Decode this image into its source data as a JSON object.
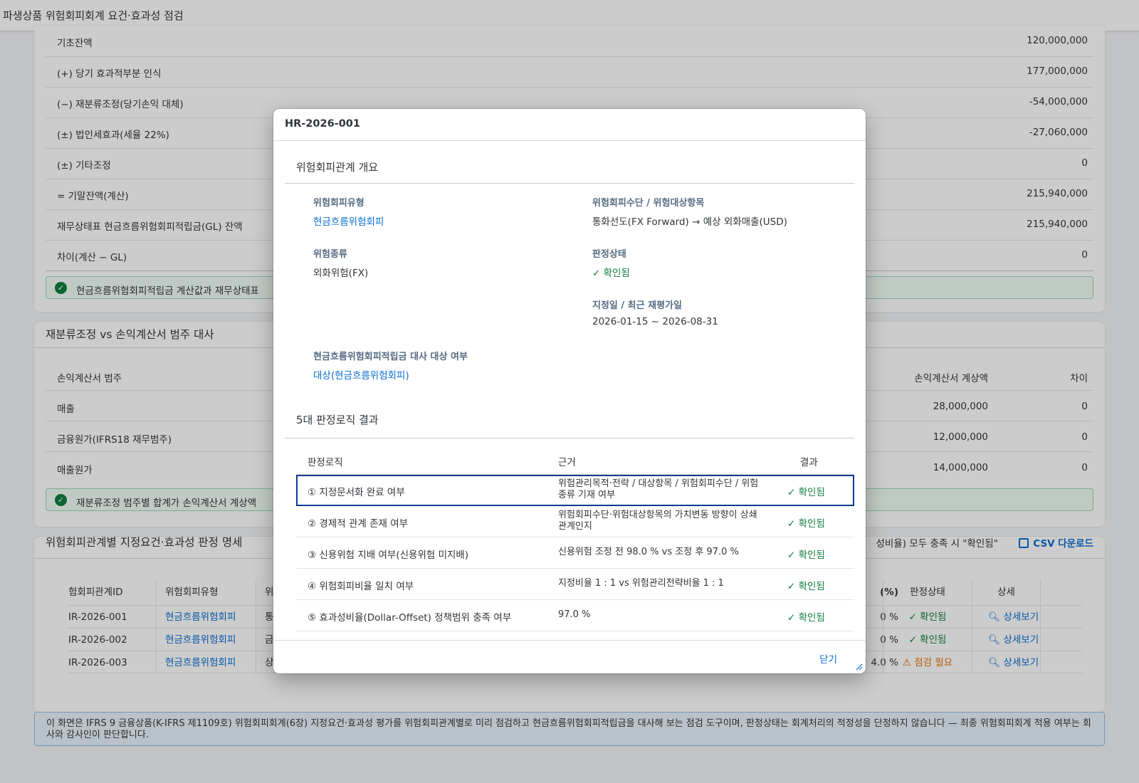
{
  "page": {
    "title": "파생상품 위험회피회계 요건·효과성 점검"
  },
  "summary": {
    "rows": [
      {
        "label": "기초잔액",
        "value": "120,000,000"
      },
      {
        "label": "(+) 당기 효과적부분 인식",
        "value": "177,000,000"
      },
      {
        "label": "(−) 재분류조정(당기손익 대체)",
        "value": "-54,000,000"
      },
      {
        "label": "(±) 법인세효과(세율 22%)",
        "value": "-27,060,000"
      },
      {
        "label": "(±) 기타조정",
        "value": "0"
      },
      {
        "label": "= 기말잔액(계산)",
        "value": "215,940,000"
      },
      {
        "label": "재무상태표 현금흐름위험회피적립금(GL) 잔액",
        "value": "215,940,000"
      },
      {
        "label": "차이(계산 − GL)",
        "value": "0"
      }
    ],
    "message": "현금흐름위험회피적립금 계산값과 재무상태표"
  },
  "reclass": {
    "title": "재분류조정 vs 손익계산서 범주 대사",
    "headers": {
      "category": "손익계산서 범주",
      "pl_amount": "손익계산서 계상액",
      "diff": "차이"
    },
    "rows": [
      {
        "category": "매출",
        "pl_amount": "28,000,000",
        "diff": "0"
      },
      {
        "category": "금융원가(IFRS18 재무범주)",
        "pl_amount": "12,000,000",
        "diff": "0"
      },
      {
        "category": "매출원가",
        "pl_amount": "14,000,000",
        "diff": "0"
      }
    ],
    "message": "재분류조정 범주별 합계가 손익계산서 계상액"
  },
  "detail": {
    "title": "위험회피관계별 지정요건·효과성 판정 명세",
    "note_right": "성비율) 모두 충족 시 \"확인됨\"",
    "csv_label": "CSV 다운로드",
    "headers": {
      "id": "험회피관계ID",
      "type": "위험회피유형",
      "col3": "위",
      "pct": "(%)",
      "status": "판정상태",
      "detail": "상세"
    },
    "rows": [
      {
        "id": "IR-2026-001",
        "type": "현금흐름위험회피",
        "col3": "통",
        "pct": "0 %",
        "status": "확인됨",
        "status_kind": "ok",
        "detail": "상세보기"
      },
      {
        "id": "IR-2026-002",
        "type": "현금흐름위험회피",
        "col3": "금",
        "pct": "0 %",
        "status": "확인됨",
        "status_kind": "ok",
        "detail": "상세보기"
      },
      {
        "id": "IR-2026-003",
        "type": "현금흐름위험회피",
        "col3": "상",
        "pct": "4.0 %",
        "status": "점검 필요",
        "status_kind": "warn",
        "detail": "상세보기"
      }
    ]
  },
  "info_text": "이 화면은 IFRS 9 금융상품(K-IFRS 제1109호) 위험회피회계(6장) 지정요건·효과성 평가를 위험회피관계별로 미리 점검하고 현금흐름위험회피적립금을 대사해 보는 점검 도구이며, 판정상태는 회계처리의 적정성을 단정하지 않습니다 — 최종 위험회피회계 적용 여부는 회사와 감사인이 판단합니다.",
  "dialog": {
    "title": "HR-2026-001",
    "overview_title": "위험회피관계 개요",
    "fields": {
      "hedge_type_label": "위험회피유형",
      "hedge_type_value": "현금흐름위험회피",
      "instrument_label": "위험회피수단 / 위험대상항목",
      "instrument_value": "통화선도(FX Forward) → 예상 외화매출(USD)",
      "risk_type_label": "위험종류",
      "risk_type_value": "외화위험(FX)",
      "status_label": "판정상태",
      "status_value": "✓ 확인됨",
      "date_label": "지정일 / 최근 재평가일",
      "date_value": "2026-01-15 ~ 2026-08-31",
      "reserve_label": "현금흐름위험회피적립금 대사 대상 여부",
      "reserve_value": "대상(현금흐름위험회피)"
    },
    "logic_title": "5대 판정로직 결과",
    "logic_headers": {
      "logic": "판정로직",
      "basis": "근거",
      "result": "결과"
    },
    "logic_rows": [
      {
        "logic": "① 지정문서화 완료 여부",
        "basis": "위험관리목적·전략 / 대상항목 / 위험회피수단 / 위험종류 기재 여부",
        "result": "확인됨"
      },
      {
        "logic": "② 경제적 관계 존재 여부",
        "basis": "위험회피수단·위험대상항목의 가치변동 방향이 상쇄관계인지",
        "result": "확인됨"
      },
      {
        "logic": "③ 신용위험 지배 여부(신용위험 미지배)",
        "basis": "신용위험 조정 전 98.0 % vs 조정 후 97.0 %",
        "result": "확인됨"
      },
      {
        "logic": "④ 위험회피비율 일치 여부",
        "basis": "지정비율 1 : 1 vs 위험관리전략비율 1 : 1",
        "result": "확인됨"
      },
      {
        "logic": "⑤ 효과성비율(Dollar-Offset) 정책범위 충족 여부",
        "basis": "97.0 %",
        "result": "확인됨"
      }
    ],
    "close_label": "닫기"
  },
  "icons": {
    "ok": "check-icon",
    "warn": "warning-icon",
    "detail": "document-search-icon",
    "csv": "table-export-icon"
  },
  "colors": {
    "accent": "#0a6ed1",
    "success": "#107e3e",
    "warning": "#e9730c",
    "selection": "#0a3d91"
  }
}
